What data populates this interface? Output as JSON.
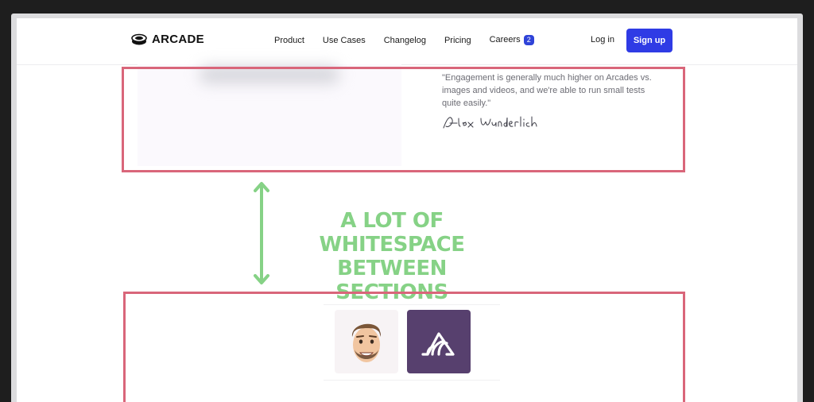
{
  "header": {
    "logo_text": "ARCADE",
    "nav": [
      "Product",
      "Use Cases",
      "Changelog",
      "Pricing",
      "Careers"
    ],
    "careers_badge": "2",
    "login_label": "Log in",
    "signup_label": "Sign up"
  },
  "testimonial": {
    "quote": "\"Engagement is generally much higher on Arcades vs. images and videos, and we're able to run small tests quite easily.\"",
    "signature": "Alex Wunderlich"
  },
  "annotation": {
    "line1": "A LOT OF WHITESPACE",
    "line2": "BETWEEN SECTIONS"
  },
  "customer_logos": [
    "smiling-man-avatar-icon",
    "sentry-brand-icon"
  ],
  "colors": {
    "accent": "#2f3be5",
    "highlight_box": "#d9667a",
    "annotation": "#86d286",
    "brand_tile": "#57406e"
  }
}
